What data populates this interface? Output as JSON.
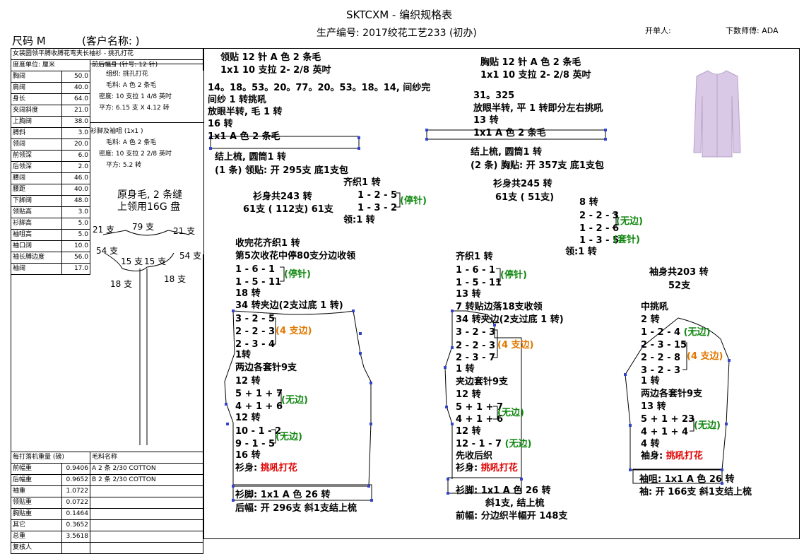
{
  "header": {
    "title": "SKTCXM - 编织规格表",
    "production_no": "生产编号: 2017绞花工艺233 (初办)",
    "issuer": "开单人:",
    "calc_master": "下数师傅: ADA",
    "size": "尺码  M",
    "customer": "(客户名称:                    )"
  },
  "left_panel": {
    "style_desc": "女装圆领平膊收膊花弯夹长袖衫 - 挑孔打花",
    "unit": "度度单位: 厘米",
    "measurements": [
      {
        "name": "胸阔",
        "value": "50.0"
      },
      {
        "name": "肩阔",
        "value": "40.0"
      },
      {
        "name": "身长",
        "value": "64.0"
      },
      {
        "name": "夹阔斜度",
        "value": "21.0"
      },
      {
        "name": "上胸阔",
        "value": "38.0"
      },
      {
        "name": "膊斜",
        "value": "3.0"
      },
      {
        "name": "领阔",
        "value": "20.0"
      },
      {
        "name": "前领深",
        "value": "6.0"
      },
      {
        "name": "后领深",
        "value": "2.0"
      },
      {
        "name": "腰阔",
        "value": "46.0"
      },
      {
        "name": "腰距",
        "value": "40.0"
      },
      {
        "name": "下脚阔",
        "value": "48.0"
      },
      {
        "name": "领贴高",
        "value": "3.0"
      },
      {
        "name": "衫脚高",
        "value": "5.0"
      },
      {
        "name": "袖咀高",
        "value": "5.0"
      },
      {
        "name": "袖口阔",
        "value": "10.0"
      },
      {
        "name": "袖长膊边度",
        "value": "56.0"
      },
      {
        "name": "袖阔",
        "value": "17.0"
      }
    ],
    "body_spec": {
      "title": "前后幅身 (针号: 12 针)",
      "lines": [
        "组织: 挑孔打花",
        "毛料: A 色 2 条毛",
        "密度:  10 支拉 1 4/8 英吋",
        "平方: 6.15 支 X 4.12 转"
      ]
    },
    "cuff_spec": {
      "title": "衫脚及袖咀 (1x1 )",
      "lines": [
        "毛料: A 色 2 条毛",
        "密度: 10 支拉 2 2/8 英吋",
        "平方: 5.2 转"
      ]
    },
    "neck_sketch": {
      "note1": "原身毛, 2 条缝",
      "note2": "上领用16G 盘",
      "labels": [
        "21 支",
        "79 支",
        "21 支",
        "54 支",
        "54 支",
        "15 支",
        "15 支",
        "18 支",
        "18 支"
      ]
    },
    "weights_title": "每打落机重量 (磅)",
    "yarn_title": "毛料名称",
    "weights": [
      {
        "name": "前幅重",
        "value": "0.9406"
      },
      {
        "name": "后幅重",
        "value": "0.9652"
      },
      {
        "name": "袖重",
        "value": "1.0722"
      },
      {
        "name": "领贴重",
        "value": "0.0722"
      },
      {
        "name": "胸贴重",
        "value": "0.1464"
      },
      {
        "name": "其它",
        "value": "0.3652"
      },
      {
        "name": "总重",
        "value": "3.5618"
      },
      {
        "name": "复核人",
        "value": ""
      }
    ],
    "yarns": [
      "A  2 条 2/30 COTTON",
      "B  2 条 2/30 COTTON"
    ]
  },
  "collar": {
    "l1": "领贴  12 针 A 色 2 条毛",
    "l2": "1x1  10 支拉 2- 2/8 英吋",
    "l3": "14。18。53。20。77。20。53。18。14, 间纱完",
    "l4": "间纱 1 转挑吼",
    "l5": "放眼半转, 毛 1 转",
    "l6": "16 转",
    "l7": "1x1  A 色 2 条毛",
    "l8": "结上梳, 圆筒1 转",
    "l9": "(1 条) 领贴: 开 295支 底1支包"
  },
  "placket": {
    "l1": "胸贴  12 针 A 色 2 条毛",
    "l2": "1x1  10 支拉 2- 2/8 英吋",
    "l3": "31。325",
    "l4": "放眼半转, 平 1 转即分左右挑吼",
    "l5": "13 转",
    "l6": "1x1  A 色 2 条毛",
    "l7": "结上梳, 圆筒1 转",
    "l8": "(2 条) 胸贴: 开 357支 底1支包"
  },
  "back": {
    "sq1": "齐织1 转",
    "sq2": "1 - 2 - 5",
    "sq3": "1 - 3 - 2",
    "sq_lbl": "(停针)",
    "collar_turns": "领:1 转",
    "body_total": "衫身共243 转",
    "body_needles": "61支 ( 112支) 61支",
    "a1": "收完花齐织1 转",
    "a2": "第5次收花中停80支分边收领",
    "a3": "1 - 6 - 1",
    "a4": "1 - 5 - 11",
    "a_lbl": "(停针)",
    "a5": "18 转",
    "a6": "34 转夹边(2支过底 1 转)",
    "a7": "3 - 2 - 5",
    "a8": "2 - 2 - 3",
    "a9": "2 - 3 - 4",
    "a_lbl2": "(4 支边)",
    "a10": "1转",
    "a11": "两边各套针9支",
    "a12": "12 转",
    "a13": "5 + 1 + 7",
    "a14": "4 + 1 + 6",
    "a_lbl3": "(无边)",
    "a15": "12 转",
    "a16": "10 - 1 - 2",
    "a17": "9 - 1 - 5",
    "a_lbl4": "(无边)",
    "a18": "16 转",
    "body_label": "衫身: ",
    "pattern": "挑吼打花",
    "hem1": "衫脚: 1x1    A 色 26 转",
    "hem2": "后幅: 开 296支  斜1支结上梳"
  },
  "front": {
    "body_total": "衫身共245 转",
    "body_needles": "61支 ( 51支)",
    "s1": "8 转",
    "s2": "2 - 2 - 3",
    "s3": "1 - 2 - 6",
    "s_lbl1": "(无边)",
    "s4": "1 - 3 - 5",
    "s_lbl2": "(套针)",
    "s5": "领:1 转",
    "b1": "齐织1 转",
    "b2": "1 - 6 - 1",
    "b3": "1 - 5 - 11",
    "b_lbl": "(停针)",
    "b4": "13 转",
    "b5": "7 转贴边落18支收领",
    "b6": "34 转夹边(2支过底 1 转)",
    "b7": "3 - 2 - 3",
    "b8": "2 - 2 - 3",
    "b9": "2 - 3 - 7",
    "b_lbl2": "(4 支边)",
    "b10": "1 转",
    "b11": "夹边套针9支",
    "b12": "12 转",
    "b13": "5 + 1 + 7",
    "b14": "4 + 1 + 6",
    "b_lbl3": "(无边)",
    "b15": "12 转",
    "b16": "12 - 1 - 7 ",
    "b16b": "(无边)",
    "b17": "先收后织",
    "body_label": "衫身: ",
    "pattern": "挑吼打花",
    "hem1": "衫脚: 1x1    A 色 26 转",
    "hem2": "斜1支, 结上梳",
    "hem3": "前幅: 分边织半幅开 148支"
  },
  "sleeve": {
    "total": "袖身共203 转",
    "needles": "52支",
    "c1": "中挑吼",
    "c2": "2 转",
    "c3": "1 - 2 - 4 ",
    "c3b": "(无边)",
    "c4": "2 - 3 - 15",
    "c5": "2 - 2 - 8",
    "c_lbl": "(4 支边)",
    "c6": "3 - 2 - 3",
    "c7": "1 转",
    "c8": "两边各套针9支",
    "c9": "13 转",
    "c10": "5 + 1 + 23",
    "c11": "4 + 1 + 4",
    "c_lbl2": "(无边)",
    "c12": "4 转",
    "body_label": "袖身: ",
    "pattern": "挑吼打花",
    "cuff1": "袖咀: 1x1    A 色 26 转",
    "cuff2": "袖: 开 166支  斜1支结上梳"
  },
  "colors": {
    "green": "#118811",
    "orange": "#e07800",
    "red": "#e00000",
    "garment": "#d9c8e6"
  }
}
